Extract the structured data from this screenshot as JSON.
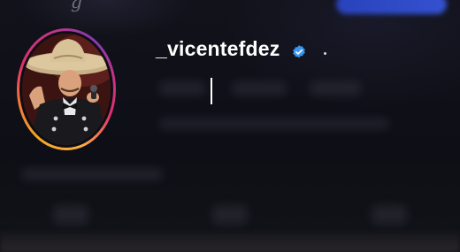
{
  "profile": {
    "username": "_vicentefdez",
    "verified": true,
    "top_partial_text": "g"
  },
  "icons": {
    "verified": "verified-badge-icon",
    "more": "dot-icon"
  },
  "colors": {
    "background": "#0d0e14",
    "verified_blue": "#3897f0",
    "story_ring": [
      "#f5a623",
      "#e1306c",
      "#833ab4"
    ],
    "follow_button": "#3a5cf0"
  }
}
